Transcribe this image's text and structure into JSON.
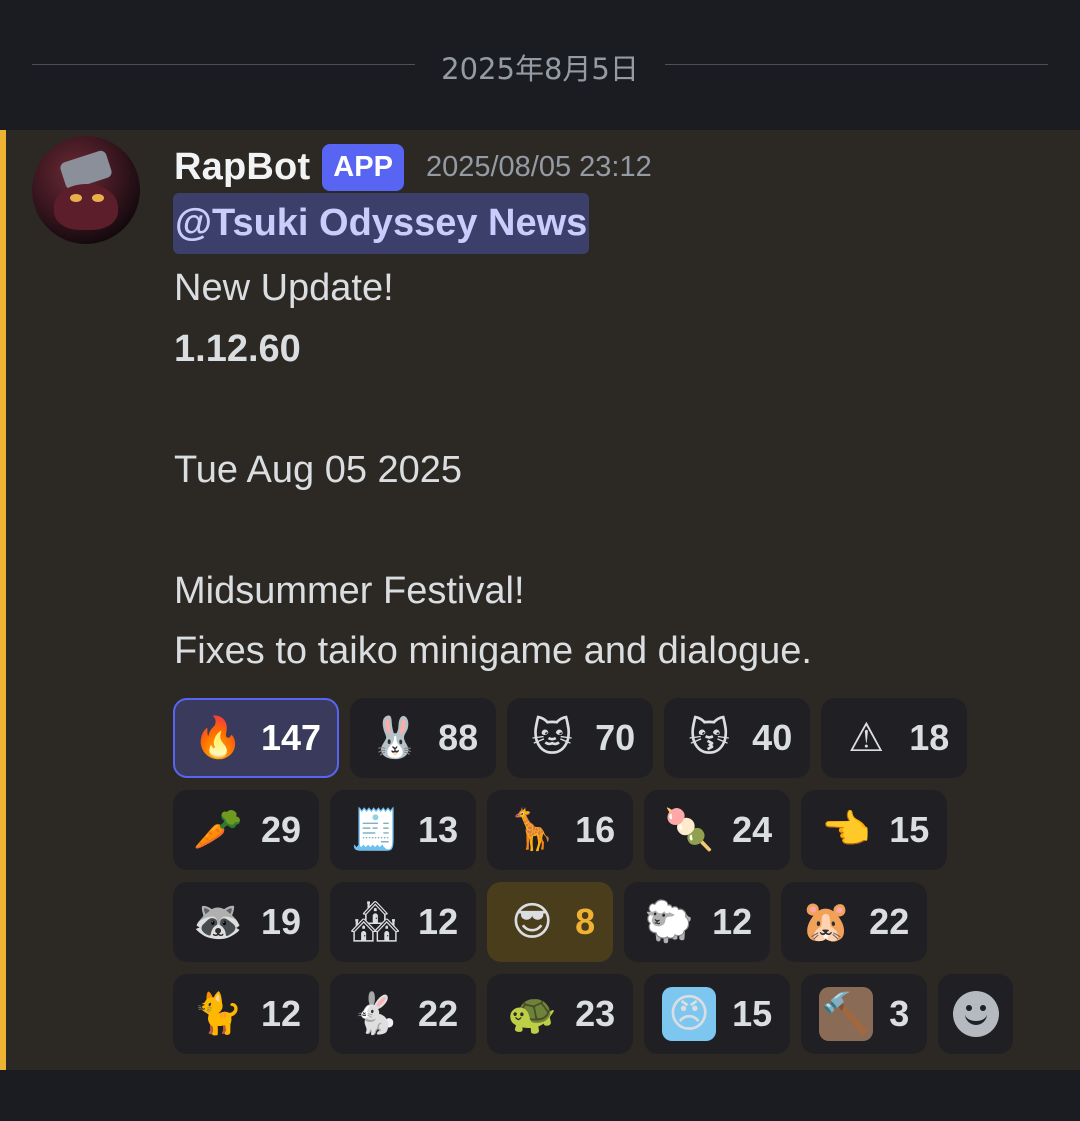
{
  "date_divider": "2025年8月5日",
  "message": {
    "username": "RapBot",
    "badge": "APP",
    "timestamp": "2025/08/05 23:12",
    "mention": "@Tsuki Odyssey News",
    "lines": [
      {
        "text": "New Update!",
        "bold": false
      },
      {
        "text": "1.12.60",
        "bold": true
      },
      {
        "text": "",
        "bold": false
      },
      {
        "text": "Tue Aug 05 2025",
        "bold": false
      },
      {
        "text": "",
        "bold": false
      },
      {
        "text": "Midsummer Festival!",
        "bold": false
      },
      {
        "text": "Fixes to taiko minigame and dialogue.",
        "bold": false
      }
    ]
  },
  "colors": {
    "accent_bar": "#f0b232",
    "message_bg": "#2c2925",
    "app_badge": "#5865f2",
    "mention_bg": "#3d3f6b"
  },
  "reactions": [
    [
      {
        "icon": "fire-icon",
        "glyph": "🔥",
        "count": "147",
        "state": "active",
        "bg": "transparent"
      },
      {
        "icon": "bunny-heart-icon",
        "glyph": "🐰",
        "count": "88",
        "state": "normal",
        "bg": "transparent"
      },
      {
        "icon": "white-cat-icon",
        "glyph": "🐱",
        "count": "70",
        "state": "normal",
        "bg": "transparent"
      },
      {
        "icon": "blushing-cat-icon",
        "glyph": "😽",
        "count": "40",
        "state": "normal",
        "bg": "transparent"
      },
      {
        "icon": "warning-icon",
        "glyph": "⚠",
        "count": "18",
        "state": "normal",
        "bg": "transparent"
      }
    ],
    [
      {
        "icon": "cow-carrot-icon",
        "glyph": "🥕",
        "count": "29",
        "state": "normal",
        "bg": "transparent"
      },
      {
        "icon": "receipt-icon",
        "glyph": "🧾",
        "count": "13",
        "state": "normal",
        "bg": "transparent"
      },
      {
        "icon": "giraffe-glasses-icon",
        "glyph": "🦒",
        "count": "16",
        "state": "normal",
        "bg": "transparent"
      },
      {
        "icon": "pink-blob-icon",
        "glyph": "🍡",
        "count": "24",
        "state": "normal",
        "bg": "transparent"
      },
      {
        "icon": "pointing-hand-icon",
        "glyph": "👈",
        "count": "15",
        "state": "normal",
        "bg": "transparent"
      }
    ],
    [
      {
        "icon": "old-raccoon-icon",
        "glyph": "🦝",
        "count": "19",
        "state": "normal",
        "bg": "transparent"
      },
      {
        "icon": "houses-icon",
        "glyph": "🏘",
        "count": "12",
        "state": "normal",
        "bg": "transparent"
      },
      {
        "icon": "cool-sunglasses-icon",
        "glyph": "😎",
        "count": "8",
        "state": "gold",
        "bg": "transparent"
      },
      {
        "icon": "sheep-person-icon",
        "glyph": "🐑",
        "count": "12",
        "state": "normal",
        "bg": "transparent"
      },
      {
        "icon": "guinea-pig-icon",
        "glyph": "🐹",
        "count": "22",
        "state": "normal",
        "bg": "transparent"
      }
    ],
    [
      {
        "icon": "cat-scarf-icon",
        "glyph": "🐈",
        "count": "12",
        "state": "normal",
        "bg": "transparent"
      },
      {
        "icon": "bunny-drink-icon",
        "glyph": "🐇",
        "count": "22",
        "state": "normal",
        "bg": "transparent"
      },
      {
        "icon": "turtle-icon",
        "glyph": "🐢",
        "count": "23",
        "state": "normal",
        "bg": "transparent"
      },
      {
        "icon": "angry-chick-icon",
        "glyph": "😠",
        "count": "15",
        "state": "normal",
        "bg": "#7cc6f0"
      },
      {
        "icon": "ban-hammer-icon",
        "glyph": "🔨",
        "count": "3",
        "state": "normal",
        "bg": "#8a6b55"
      }
    ]
  ],
  "add_reaction_icon": "add-reaction-smiley-icon"
}
